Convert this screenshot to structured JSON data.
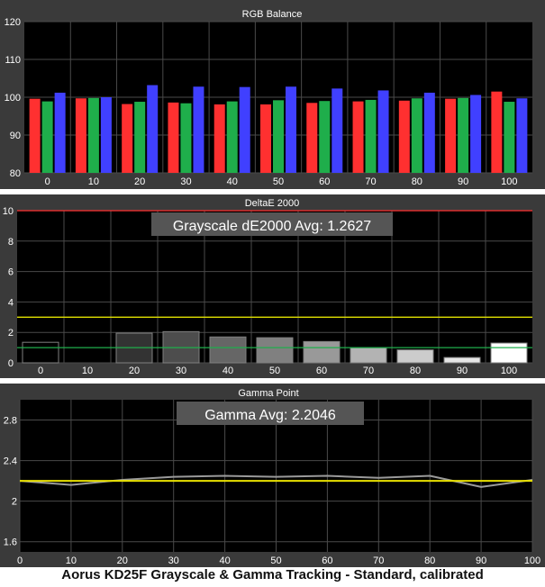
{
  "figure_caption": "Aorus KD25F Grayscale & Gamma Tracking - Standard, calibrated",
  "chart_data": [
    {
      "type": "bar",
      "title": "RGB Balance",
      "categories": [
        "0",
        "10",
        "20",
        "30",
        "40",
        "50",
        "60",
        "70",
        "80",
        "90",
        "100"
      ],
      "ylim": [
        80,
        120
      ],
      "yticks": [
        80,
        90,
        100,
        110,
        120
      ],
      "series": [
        {
          "color": "#ff3030",
          "values": [
            99.6,
            99.7,
            98.2,
            98.6,
            98.1,
            98.1,
            98.5,
            98.9,
            99.1,
            99.6,
            101.5
          ]
        },
        {
          "color": "#1fae4b",
          "values": [
            98.9,
            99.8,
            98.8,
            98.4,
            98.9,
            99.2,
            99.0,
            99.3,
            99.7,
            99.8,
            98.8
          ]
        },
        {
          "color": "#4040ff",
          "values": [
            101.2,
            100.0,
            103.2,
            102.8,
            102.7,
            102.8,
            102.3,
            101.8,
            101.2,
            100.6,
            99.7
          ]
        }
      ],
      "grid": true
    },
    {
      "type": "bar",
      "title": "DeltaE 2000",
      "annotation": "Grayscale dE2000 Avg: 1.2627",
      "categories": [
        "0",
        "10",
        "20",
        "30",
        "40",
        "50",
        "60",
        "70",
        "80",
        "90",
        "100"
      ],
      "values": [
        1.35,
        0.0,
        1.95,
        2.05,
        1.7,
        1.65,
        1.4,
        1.0,
        0.85,
        0.35,
        1.3
      ],
      "ylim": [
        0,
        10
      ],
      "yticks": [
        0,
        2,
        4,
        6,
        8,
        10
      ],
      "reference_lines": [
        {
          "value": 10,
          "color": "#ff3030"
        },
        {
          "value": 3,
          "color": "#e0e000"
        },
        {
          "value": 1,
          "color": "#1fae4b"
        }
      ],
      "grid": true
    },
    {
      "type": "line",
      "title": "Gamma Point",
      "annotation": "Gamma Avg: 2.2046",
      "x": [
        0,
        10,
        20,
        30,
        40,
        50,
        60,
        70,
        80,
        90,
        100
      ],
      "y": [
        2.2,
        2.16,
        2.21,
        2.24,
        2.25,
        2.24,
        2.25,
        2.23,
        2.25,
        2.14,
        2.21
      ],
      "target": 2.2,
      "xlim": [
        0,
        100
      ],
      "ylim": [
        1.5,
        3.0
      ],
      "yticks": [
        "1.6",
        "2",
        "2.4",
        "2.8"
      ],
      "xticks": [
        "0",
        "10",
        "20",
        "30",
        "40",
        "50",
        "60",
        "70",
        "80",
        "90",
        "100"
      ],
      "series_color": "#9a9a9a",
      "target_color": "#e8e000",
      "grid": true
    }
  ]
}
